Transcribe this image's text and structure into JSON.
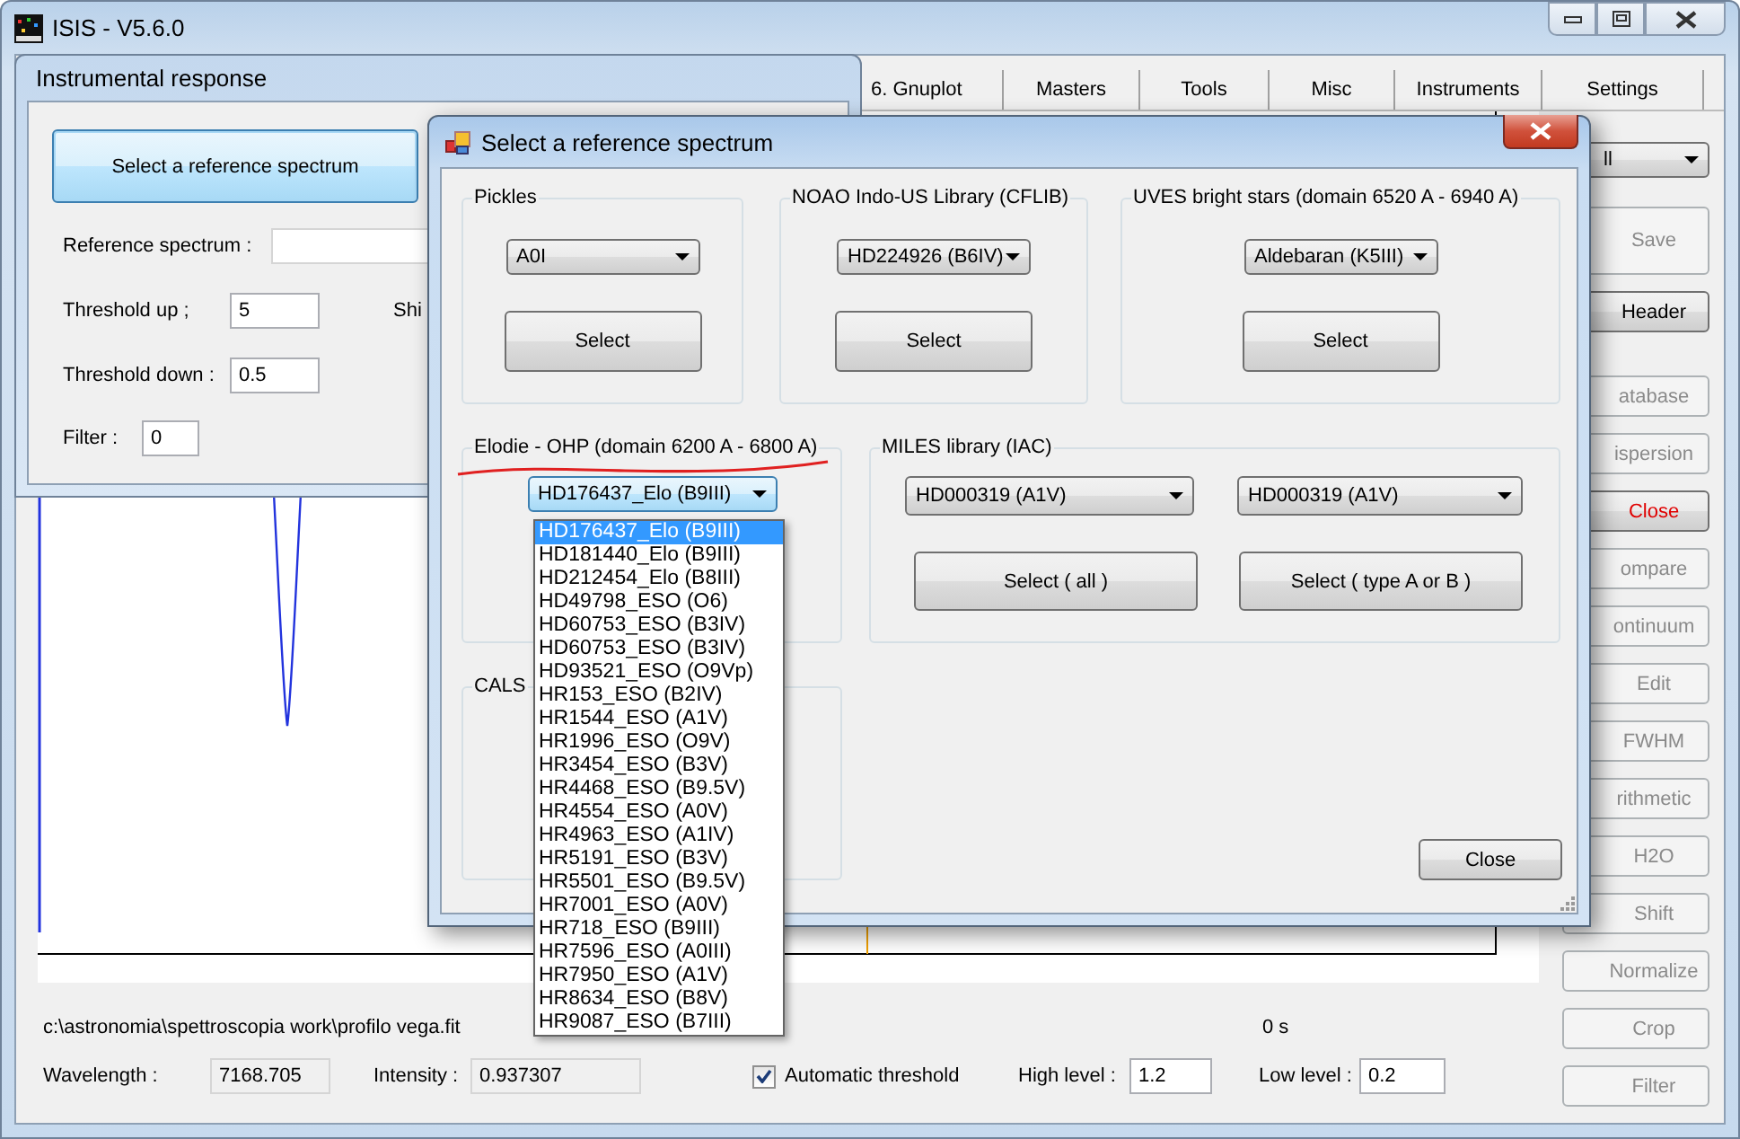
{
  "main_window": {
    "title": "ISIS - V5.6.0",
    "tabs": [
      "6. Gnuplot",
      "Masters",
      "Tools",
      "Misc",
      "Instruments",
      "Settings"
    ],
    "mode_dropdown": {
      "value": "ll"
    },
    "side_buttons": [
      {
        "label": "Save",
        "disabled": true,
        "kind": "normal"
      },
      {
        "label": "Header",
        "disabled": false,
        "kind": "normal"
      },
      {
        "label": "atabase",
        "disabled": true,
        "kind": "normal"
      },
      {
        "label": "ispersion",
        "disabled": true,
        "kind": "normal"
      },
      {
        "label": "Close",
        "disabled": false,
        "kind": "danger"
      },
      {
        "label": "ompare",
        "disabled": true,
        "kind": "normal"
      },
      {
        "label": "ontinuum",
        "disabled": true,
        "kind": "normal"
      },
      {
        "label": "Edit",
        "disabled": true,
        "kind": "normal"
      },
      {
        "label": "FWHM",
        "disabled": true,
        "kind": "normal"
      },
      {
        "label": "rithmetic",
        "disabled": true,
        "kind": "normal"
      },
      {
        "label": "H2O",
        "disabled": true,
        "kind": "normal"
      },
      {
        "label": "Shift",
        "disabled": true,
        "kind": "normal"
      },
      {
        "label": "Normalize",
        "disabled": true,
        "kind": "normal"
      },
      {
        "label": "Crop",
        "disabled": true,
        "kind": "normal"
      },
      {
        "label": "Filter",
        "disabled": true,
        "kind": "normal"
      }
    ],
    "status": {
      "file_path": "c:\\astronomia\\spettroscopia work\\profilo vega.fit",
      "elapsed": "0 s",
      "wavelength_label": "Wavelength :",
      "wavelength": "7168.705",
      "intensity_label": "Intensity :",
      "intensity": "0.937307",
      "auto_threshold": {
        "label": "Automatic threshold",
        "checked": true
      },
      "high_level_label": "High level :",
      "high_level": "1.2",
      "low_level_label": "Low level :",
      "low_level": "0.2"
    }
  },
  "response_window": {
    "title": "Instrumental response",
    "select_button": {
      "label": "Select a reference spectrum",
      "focused": true
    },
    "reference_label": "Reference spectrum :",
    "threshold_up": {
      "label": "Threshold up ;",
      "value": "5"
    },
    "shift_label": "Shi",
    "threshold_down": {
      "label": "Threshold down :",
      "value": "0.5"
    },
    "filter": {
      "label": "Filter :",
      "value": "0"
    }
  },
  "dialog": {
    "title": "Select a reference spectrum",
    "groups": [
      {
        "kind": "single",
        "title": "Pickles",
        "dropdown": "A0I",
        "button": "Select"
      },
      {
        "kind": "single",
        "title": "NOAO Indo-US Library (CFLIB)",
        "dropdown": "HD224926 (B6IV)",
        "button": "Select"
      },
      {
        "kind": "single",
        "title": "UVES bright stars (domain 6520 A - 6940 A)",
        "dropdown": "Aldebaran (K5III)",
        "button": "Select"
      },
      {
        "kind": "list",
        "title": "Elodie - OHP (domain 6200 A - 6800 A)",
        "dropdown": "HD176437_Elo (B9III)",
        "expanded": true,
        "options": [
          {
            "label": "HD176437_Elo (B9III)",
            "selected": true
          },
          {
            "label": "HD181440_Elo (B9III)",
            "selected": false
          },
          {
            "label": "HD212454_Elo (B8III)",
            "selected": false
          },
          {
            "label": "HD49798_ESO (O6)",
            "selected": false
          },
          {
            "label": "HD60753_ESO (B3IV)",
            "selected": false
          },
          {
            "label": "HD60753_ESO (B3IV)",
            "selected": false
          },
          {
            "label": "HD93521_ESO (O9Vp)",
            "selected": false
          },
          {
            "label": "HR153_ESO (B2IV)",
            "selected": false
          },
          {
            "label": "HR1544_ESO (A1V)",
            "selected": false
          },
          {
            "label": "HR1996_ESO (O9V)",
            "selected": false
          },
          {
            "label": "HR3454_ESO (B3V)",
            "selected": false
          },
          {
            "label": "HR4468_ESO (B9.5V)",
            "selected": false
          },
          {
            "label": "HR4554_ESO (A0V)",
            "selected": false
          },
          {
            "label": "HR4963_ESO (A1IV)",
            "selected": false
          },
          {
            "label": "HR5191_ESO (B3V)",
            "selected": false
          },
          {
            "label": "HR5501_ESO (B9.5V)",
            "selected": false
          },
          {
            "label": "HR7001_ESO (A0V)",
            "selected": false
          },
          {
            "label": "HR718_ESO (B9III)",
            "selected": false
          },
          {
            "label": "HR7596_ESO (A0III)",
            "selected": false
          },
          {
            "label": "HR7950_ESO (A1V)",
            "selected": false
          },
          {
            "label": "HR8634_ESO (B8V)",
            "selected": false
          },
          {
            "label": "HR9087_ESO (B7III)",
            "selected": false
          }
        ]
      },
      {
        "kind": "double",
        "title": "MILES library (IAC)",
        "dropdowns": [
          "HD000319  (A1V)",
          "HD000319  (A1V)"
        ],
        "buttons": [
          "Select ( all )",
          "Select ( type A or B )"
        ]
      },
      {
        "kind": "empty",
        "title": "CALS"
      }
    ],
    "close_button": "Close"
  }
}
